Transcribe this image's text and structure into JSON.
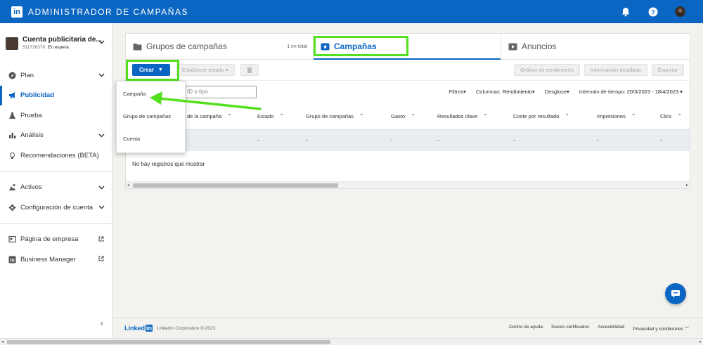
{
  "topbar": {
    "logo": "in",
    "title": "ADMINISTRADOR DE CAMPAÑAS"
  },
  "account": {
    "name": "Cuenta publicitaria de...",
    "id": "511726370",
    "status": "En espera"
  },
  "sidebar": {
    "items": [
      {
        "label": "Plan",
        "icon": "compass-icon"
      },
      {
        "label": "Publicidad",
        "icon": "megaphone-icon"
      },
      {
        "label": "Prueba",
        "icon": "flask-icon"
      },
      {
        "label": "Análisis",
        "icon": "bar-chart-icon"
      },
      {
        "label": "Recomendaciones (BETA)",
        "icon": "lightbulb-icon"
      },
      {
        "label": "Activos",
        "icon": "assets-icon"
      },
      {
        "label": "Configuración de cuenta",
        "icon": "gear-icon"
      },
      {
        "label": "Página de empresa",
        "icon": "page-icon"
      },
      {
        "label": "Business Manager",
        "icon": "linkedin-icon"
      }
    ],
    "collapse": "‹"
  },
  "tabs": {
    "groups": "Grupos de campañas",
    "groups_count": "1 en total",
    "campaigns": "Campañas",
    "ads": "Anuncios"
  },
  "toolbar": {
    "create": "Crear",
    "set_status": "Establecer estado",
    "perf_chart": "Gráfico de rendimiento",
    "detailed_info": "Información detallada",
    "export": "Exportar"
  },
  "filters": {
    "search_placeholder": "ID o tipo",
    "filters": "Filtros",
    "columns_label": "Columnas:",
    "columns_value": "Rendimiento",
    "breakdown": "Desglose",
    "time_label": "Intervalo de tiempo:",
    "time_value": "20/3/2023 - 18/4/2023"
  },
  "table": {
    "headers": [
      "de la campaña",
      "Estado",
      "Grupo de campañas",
      "Gasto",
      "Resultados clave",
      "Coste por resultado",
      "Impresiones",
      "Clics"
    ],
    "row": [
      "-",
      "-",
      "-",
      "-",
      "-",
      "-",
      "-"
    ],
    "empty": "No hay registros que mostrar"
  },
  "dropdown": {
    "items": [
      "Campaña",
      "Grupo de campañas",
      "Cuenta"
    ]
  },
  "footer": {
    "brand": "Linked",
    "brand_in": "in",
    "copyright": "LinkedIn Corporation © 2023",
    "links": [
      "Centro de ayuda",
      "Socios certificados",
      "Accesibilidad",
      "Privacidad y condiciones"
    ]
  },
  "colors": {
    "brand": "#0a66c2",
    "highlight": "#55e01f"
  }
}
